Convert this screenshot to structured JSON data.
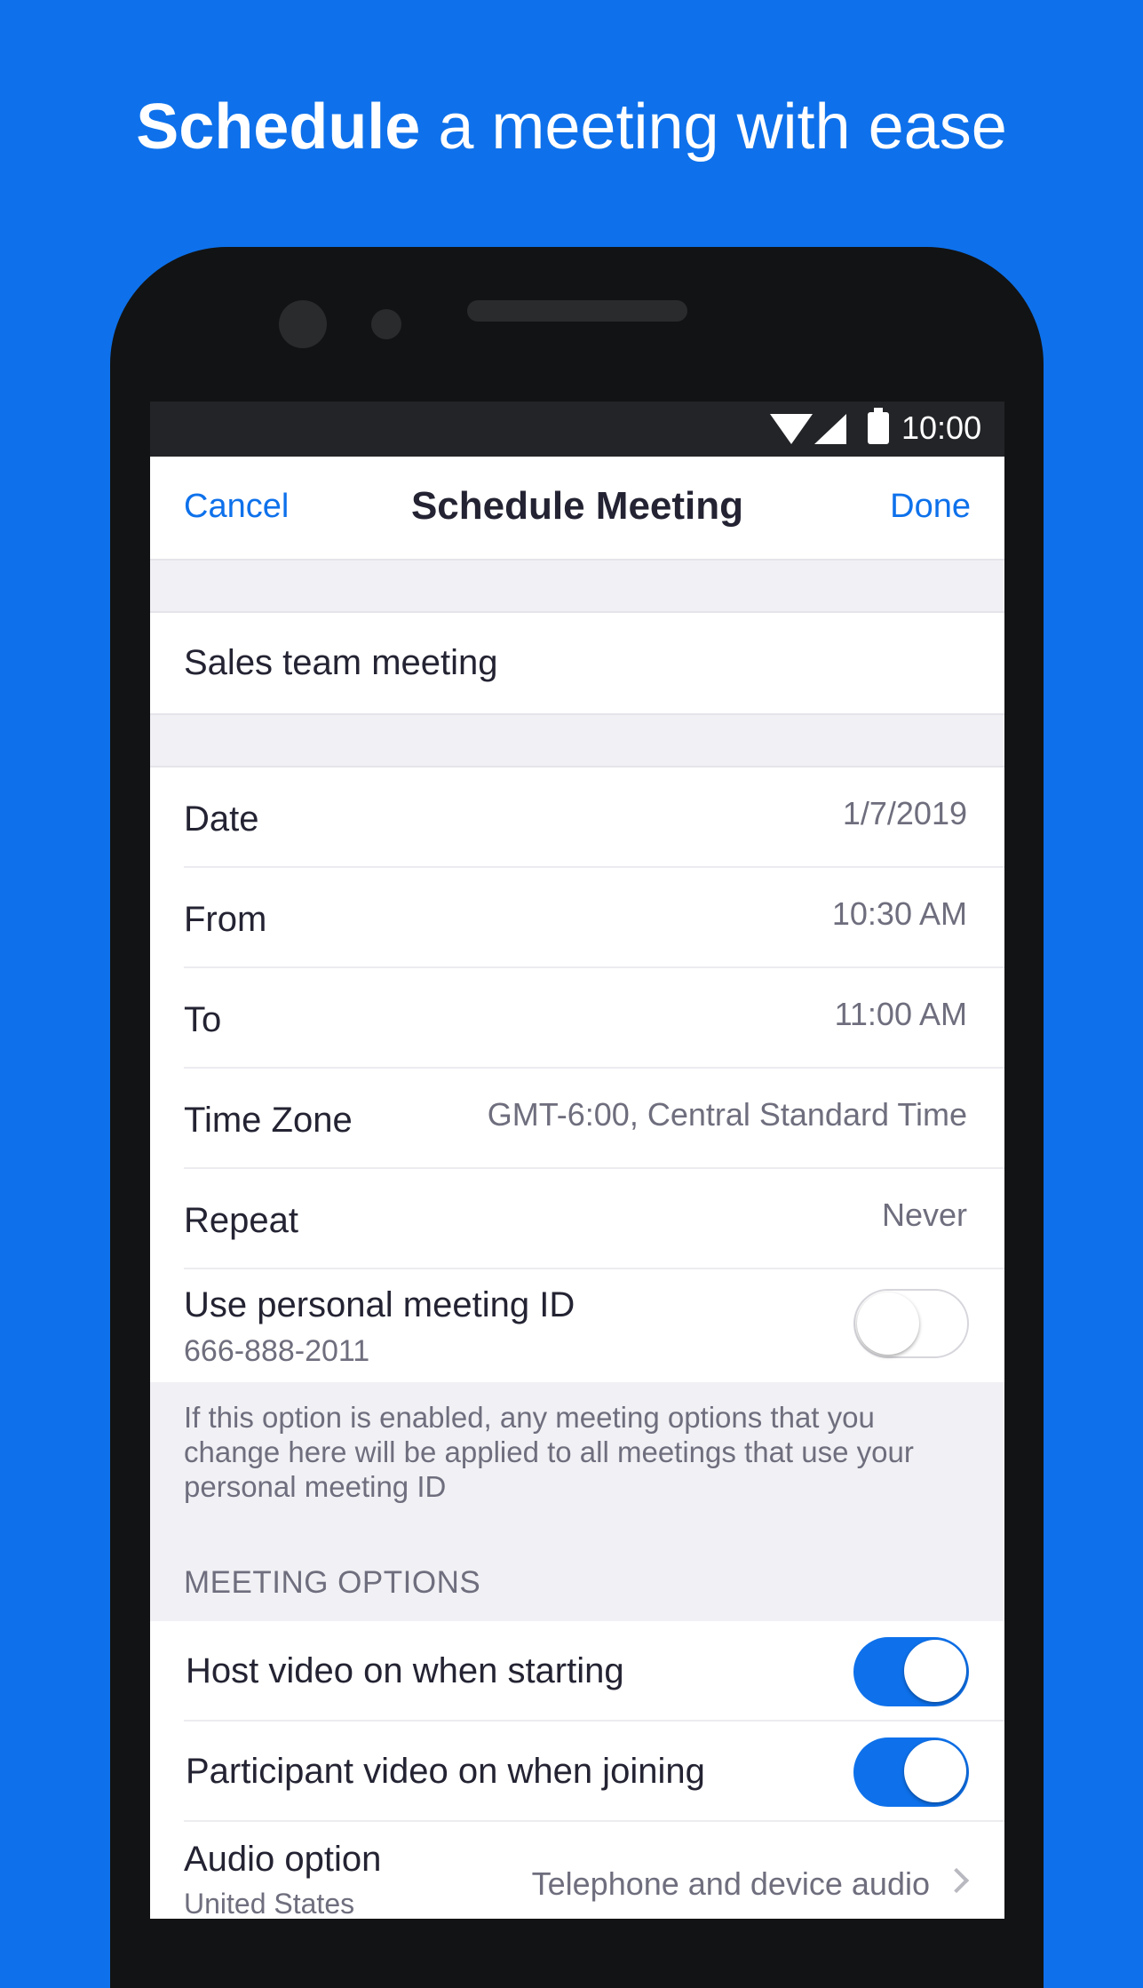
{
  "headline": {
    "bold": "Schedule",
    "rest": " a meeting with ease"
  },
  "status_bar": {
    "time": "10:00",
    "icons": [
      "wifi-icon",
      "signal-icon",
      "battery-icon"
    ]
  },
  "nav": {
    "cancel": "Cancel",
    "title": "Schedule Meeting",
    "done": "Done"
  },
  "topic": {
    "value": "Sales team meeting"
  },
  "details": [
    {
      "label": "Date",
      "value": "1/7/2019"
    },
    {
      "label": "From",
      "value": "10:30 AM"
    },
    {
      "label": "To",
      "value": "11:00 AM"
    },
    {
      "label": "Time Zone",
      "value": "GMT-6:00, Central Standard Time"
    },
    {
      "label": "Repeat",
      "value": "Never"
    }
  ],
  "personal_meeting_id": {
    "label": "Use personal meeting ID",
    "id": "666-888-2011",
    "enabled": false
  },
  "note": "If this option is enabled, any meeting options that you change here will be applied to all meetings that use your personal meeting ID",
  "meeting_options": {
    "header": "MEETING OPTIONS",
    "items": [
      {
        "label": "Host video on when starting",
        "enabled": true
      },
      {
        "label": "Participant video on when joining",
        "enabled": true
      }
    ],
    "audio": {
      "label": "Audio option",
      "sub": "United States",
      "value": "Telephone and device audio"
    }
  },
  "colors": {
    "accent": "#0E71EB",
    "background": "#0E71EB",
    "text": "#232333",
    "secondary": "#6E6E7E"
  }
}
